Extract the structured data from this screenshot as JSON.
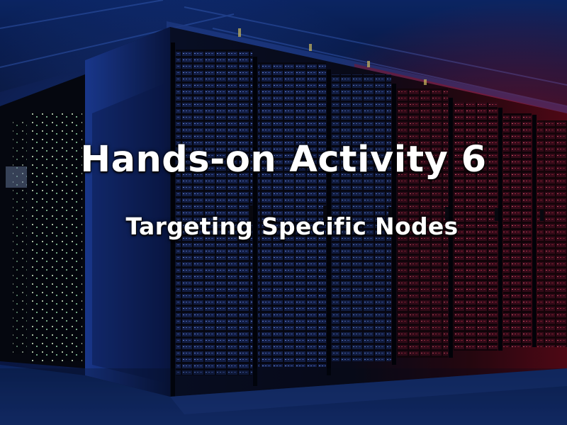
{
  "slide": {
    "title": "Hands-on Activity 6",
    "subtitle": "Targeting Specific Nodes"
  },
  "palette": {
    "cool_blue": "#1a3f9a",
    "deep_navy": "#050a1c",
    "server_red": "#c8102e",
    "led_green": "#cfe9c9",
    "rack_black": "#0b0d16"
  }
}
